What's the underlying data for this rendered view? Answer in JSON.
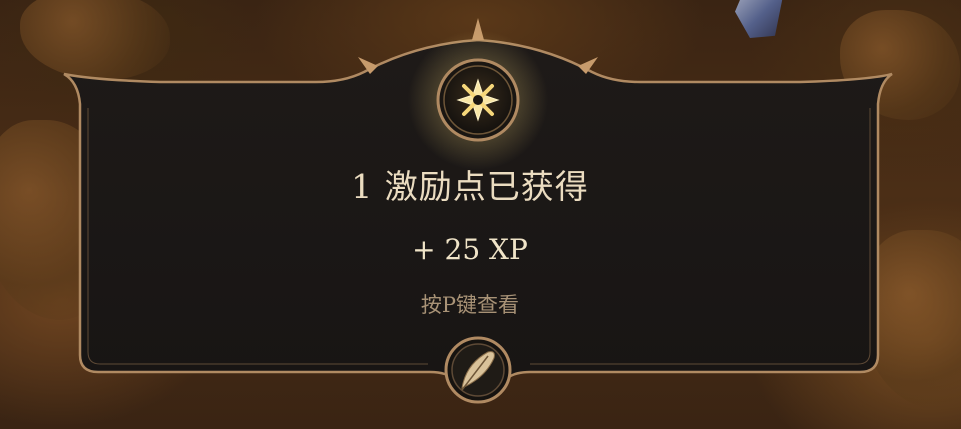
{
  "notification": {
    "title": "1 激励点已获得",
    "reward": "+ 25 XP",
    "hint": "按P键查看"
  },
  "icons": {
    "top": "inspiration-star-icon",
    "bottom": "quill-icon"
  },
  "colors": {
    "panel": "#1b1817",
    "border": "#b08a62",
    "title_text": "#ebdcc0",
    "hint_text": "#a89276",
    "star_glow": "#f6d77a"
  }
}
